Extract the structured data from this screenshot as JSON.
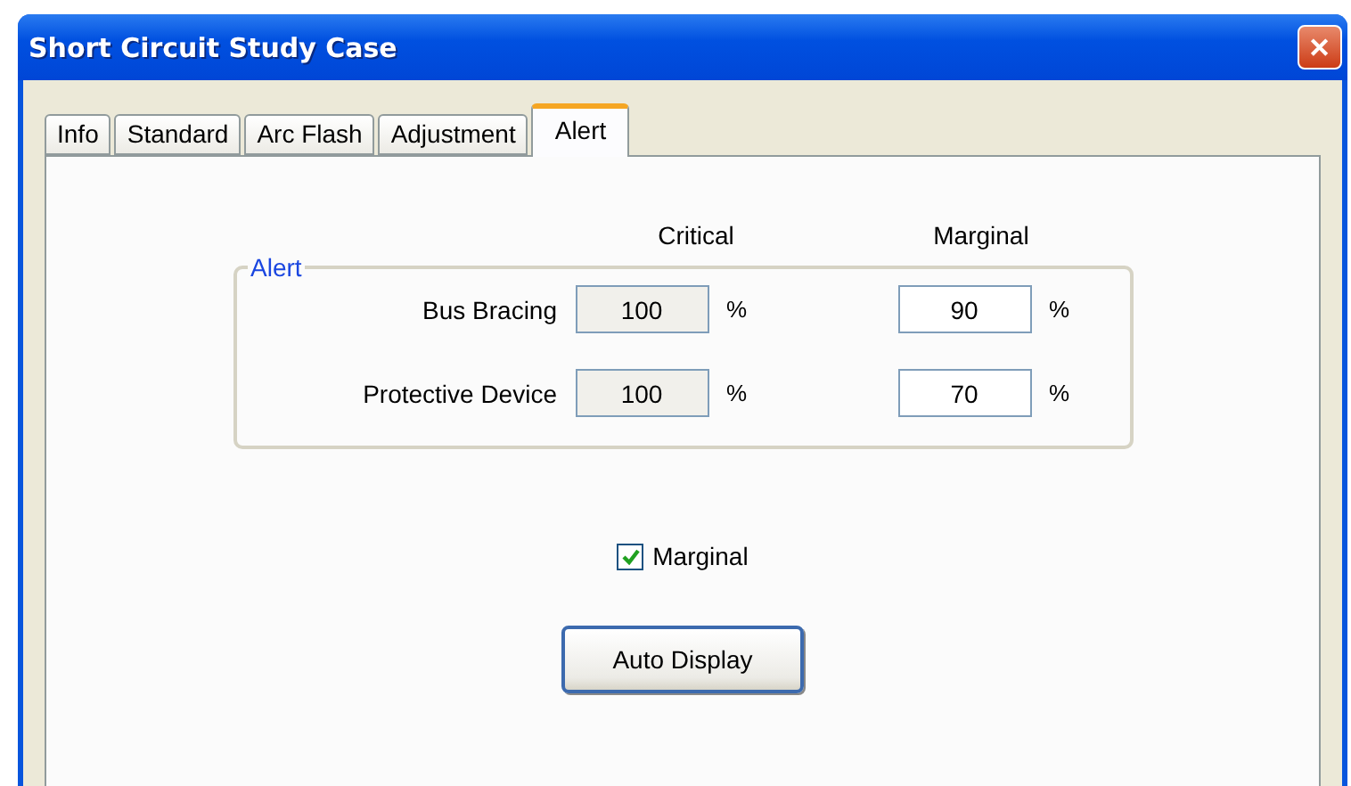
{
  "window": {
    "title": "Short Circuit Study Case",
    "close": "✕"
  },
  "tabs": [
    {
      "label": "Info",
      "selected": false
    },
    {
      "label": "Standard",
      "selected": false
    },
    {
      "label": "Arc Flash",
      "selected": false
    },
    {
      "label": "Adjustment",
      "selected": false
    },
    {
      "label": "Alert",
      "selected": true
    }
  ],
  "columns": [
    "Critical",
    "Marginal"
  ],
  "group": {
    "title": "Alert",
    "rows": [
      {
        "label": "Bus Bracing",
        "critical": "100",
        "critical_unit": "%",
        "marginal": "90",
        "marginal_unit": "%"
      },
      {
        "label": "Protective Device",
        "critical": "100",
        "critical_unit": "%",
        "marginal": "70",
        "marginal_unit": "%"
      }
    ]
  },
  "checkbox": {
    "label": "Marginal",
    "checked": true
  },
  "button": {
    "label": "Auto Display"
  }
}
